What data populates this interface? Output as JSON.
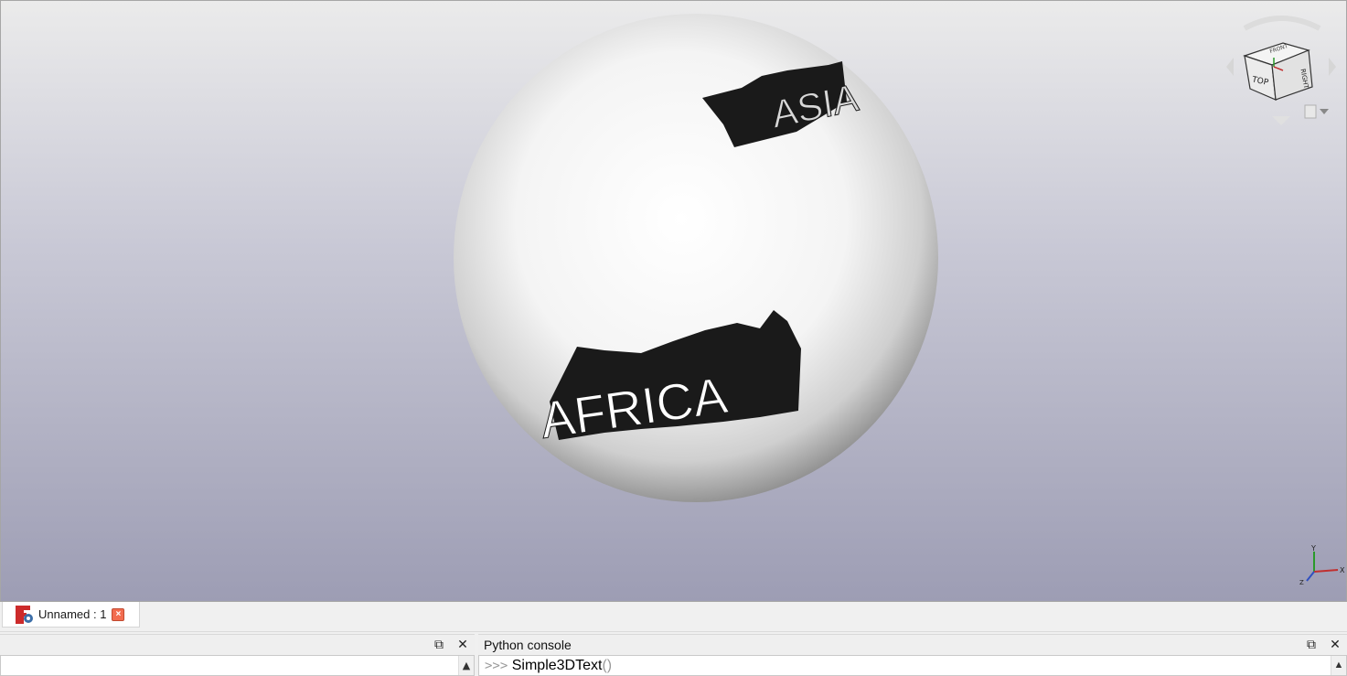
{
  "viewport": {
    "labels": {
      "asia": "ASIA",
      "africa": "AFRICA"
    },
    "navcube": {
      "face_top": "TOP",
      "face_right": "RIGHT",
      "face_front": "FRONT"
    },
    "axes": {
      "x": "X",
      "y": "Y",
      "z": "Z"
    }
  },
  "document_tab": {
    "title": "Unnamed : 1"
  },
  "left_dock": {
    "title": ""
  },
  "python_console": {
    "title": "Python console",
    "prompt": ">>>",
    "command": "Simple3DText",
    "args": "()"
  },
  "colors": {
    "sphere": "#ffffff",
    "text_extrusion": "#1a1a1a",
    "background_top": "#ebebeb",
    "background_bottom": "#9d9db4",
    "close_button": "#f26c4f"
  }
}
